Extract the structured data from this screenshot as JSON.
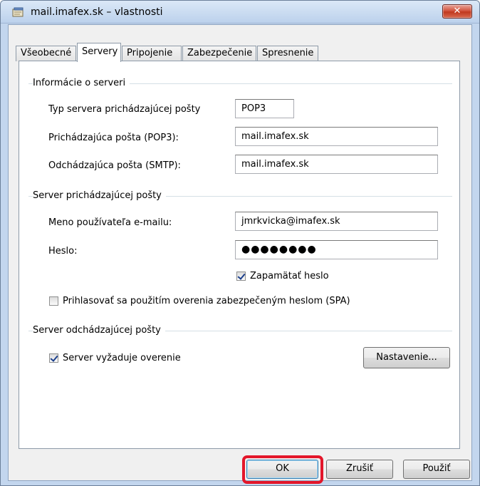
{
  "window": {
    "title": "mail.imafex.sk – vlastnosti",
    "close_label": "✕"
  },
  "tabs": [
    {
      "label": "Všeobecné"
    },
    {
      "label": "Servery"
    },
    {
      "label": "Pripojenie"
    },
    {
      "label": "Zabezpečenie"
    },
    {
      "label": "Spresnenie"
    }
  ],
  "active_tab": "Servery",
  "server_info": {
    "heading": "Informácie o serveri",
    "type_label": "Typ servera prichádzajúcej pošty",
    "type_value": "POP3",
    "incoming_label": "Prichádzajúca pošta (POP3):",
    "incoming_value": "mail.imafex.sk",
    "outgoing_label": "Odchádzajúca pošta (SMTP):",
    "outgoing_value": "mail.imafex.sk"
  },
  "incoming_server": {
    "heading": "Server prichádzajúcej pošty",
    "username_label": "Meno používateľa e-mailu:",
    "username_value": "jmrkvicka@imafex.sk",
    "password_label": "Heslo:",
    "password_value": "●●●●●●●●",
    "remember_label": "Zapamätať heslo",
    "remember_checked": true,
    "spa_label": "Prihlasovať sa použitím overenia zabezpečeným heslom (SPA)",
    "spa_checked": false
  },
  "outgoing_server": {
    "heading": "Server odchádzajúcej pošty",
    "auth_label": "Server vyžaduje overenie",
    "auth_checked": true,
    "settings_button": "Nastavenie..."
  },
  "buttons": {
    "ok": "OK",
    "cancel": "Zrušiť",
    "apply": "Použiť"
  },
  "colors": {
    "highlight_ring": "#e3162a",
    "close_button": "#c0381f"
  }
}
